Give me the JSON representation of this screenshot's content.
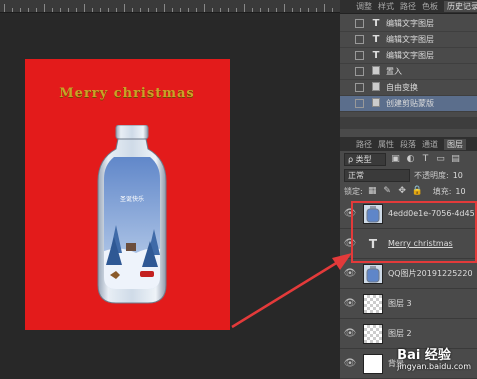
{
  "history_tabs": [
    "调整",
    "样式",
    "路径",
    "色板",
    "历史记录"
  ],
  "history_items": [
    {
      "icon": "T",
      "label": "编辑文字图层",
      "selected": false
    },
    {
      "icon": "T",
      "label": "编辑文字图层",
      "selected": false
    },
    {
      "icon": "T",
      "label": "编辑文字图层",
      "selected": false
    },
    {
      "icon": "doc",
      "label": "置入",
      "selected": false
    },
    {
      "icon": "doc",
      "label": "自由变换",
      "selected": false
    },
    {
      "icon": "doc",
      "label": "创建剪贴蒙版",
      "selected": true
    }
  ],
  "layers_tabs": [
    "路径",
    "属性",
    "段落",
    "通道",
    "图层"
  ],
  "filter": {
    "kind_label": "ρ 类型"
  },
  "blend": {
    "mode": "正常",
    "opacity_label": "不透明度:",
    "opacity_value": "10"
  },
  "lock": {
    "label": "锁定:",
    "fill_label": "填充:",
    "fill_value": "10"
  },
  "layers": [
    {
      "type": "image",
      "name": "4edd0e1e-7056-4d45",
      "underline": false,
      "thumb": "bottle"
    },
    {
      "type": "text",
      "name": "Merry christmas",
      "underline": true
    },
    {
      "type": "image",
      "name": "QQ图片20191225220",
      "underline": false,
      "thumb": "bottle-small"
    },
    {
      "type": "image",
      "name": "图层 3",
      "underline": false,
      "thumb": "checker"
    },
    {
      "type": "image",
      "name": "图层 2",
      "underline": false,
      "thumb": "checker"
    },
    {
      "type": "image",
      "name": "背景",
      "underline": false,
      "thumb": "white"
    }
  ],
  "canvas": {
    "title_text": "Merry christmas",
    "bottle_text": "圣诞快乐"
  },
  "watermark": {
    "main": "Bai 经验",
    "sub": "jingyan.baidu.com"
  },
  "colors": {
    "canvas_red": "#e31b1b",
    "highlight": "#e33a3a",
    "selection": "#5b6e8c",
    "gold": "#c9a227"
  }
}
